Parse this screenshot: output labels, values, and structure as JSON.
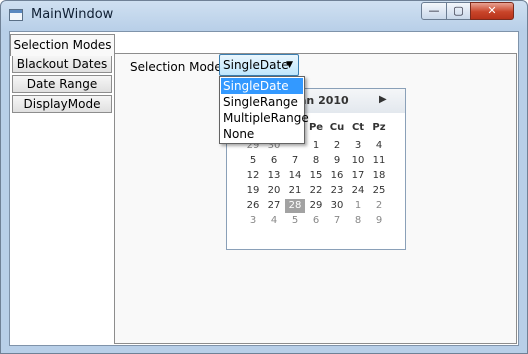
{
  "window": {
    "title": "MainWindow",
    "min_glyph": "—",
    "max_glyph": "▢",
    "close_glyph": "✕"
  },
  "tabs": [
    {
      "label": "Selection Modes",
      "selected": true
    },
    {
      "label": "Blackout Dates",
      "selected": false
    },
    {
      "label": "Date Range",
      "selected": false
    },
    {
      "label": "DisplayMode",
      "selected": false
    }
  ],
  "selection_mode": {
    "label": "Selection Mode:",
    "value": "SingleDate",
    "arrow": "▼",
    "options": [
      "SingleDate",
      "SingleRange",
      "MultipleRange",
      "None"
    ],
    "highlighted_option": "SingleDate"
  },
  "calendar": {
    "month_title": "Ocak 2010",
    "visible_month_fragment": "an 2010",
    "next_glyph": "▶",
    "day_headers_visible": [
      "Pe",
      "Cu",
      "Ct",
      "Pz"
    ],
    "weeks": [
      [
        "29",
        "30",
        "1",
        "2",
        "3",
        "4"
      ],
      [
        "5",
        "6",
        "7",
        "8",
        "9",
        "10",
        "11"
      ],
      [
        "12",
        "13",
        "14",
        "15",
        "16",
        "17",
        "18"
      ],
      [
        "19",
        "20",
        "21",
        "22",
        "23",
        "24",
        "25"
      ],
      [
        "26",
        "27",
        "28",
        "29",
        "30",
        "1",
        "2"
      ],
      [
        "3",
        "4",
        "5",
        "6",
        "7",
        "8",
        "9"
      ]
    ],
    "selected_day": "28"
  },
  "colors": {
    "highlight": "#3399ff",
    "selected_day_bg": "#a2a2a2",
    "close_button": "#c9452a"
  }
}
